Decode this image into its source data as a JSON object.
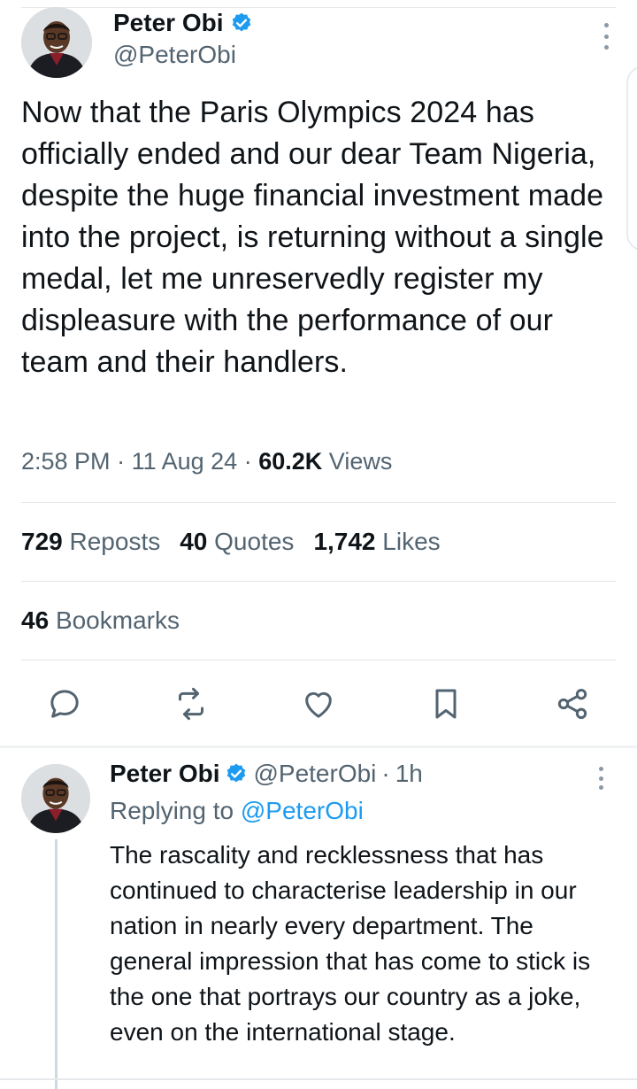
{
  "tweet": {
    "author_name": "Peter Obi",
    "author_handle": "@PeterObi",
    "verified_icon": "verified-badge-icon",
    "text": "Now that the Paris Olympics 2024 has officially ended and our dear Team Nigeria, despite the huge financial investment made into the project, is returning without a single medal, let me unreservedly register my displeasure with the performance of our team and their handlers.",
    "time": "2:58 PM",
    "date": "11 Aug 24",
    "views_count": "60.2K",
    "views_label": "Views",
    "reposts_count": "729",
    "reposts_label": "Reposts",
    "quotes_count": "40",
    "quotes_label": "Quotes",
    "likes_count": "1,742",
    "likes_label": "Likes",
    "bookmarks_count": "46",
    "bookmarks_label": "Bookmarks"
  },
  "actions": [
    "reply-icon",
    "repost-icon",
    "like-icon",
    "bookmark-icon",
    "share-icon"
  ],
  "reply": {
    "author_name": "Peter Obi",
    "author_handle": "@PeterObi",
    "time_ago": "1h",
    "replying_prefix": "Replying to",
    "replying_to": "@PeterObi",
    "text": "The rascality and recklessness that has continued to characterise leadership in our nation in nearly every department. The general impression that has come to stick is the one that portrays our country as a joke, even on the international stage."
  },
  "colors": {
    "text": "#0f1419",
    "secondary": "#536471",
    "accent": "#1d9bf0",
    "divider": "#e1e6ea"
  }
}
